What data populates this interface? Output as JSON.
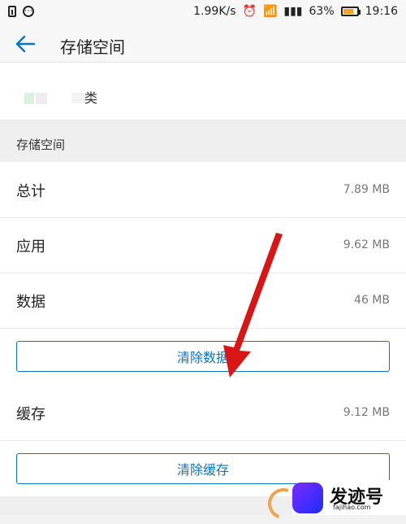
{
  "status_bar": {
    "speed": "1.99K/s",
    "battery": "63%",
    "time": "19:16"
  },
  "header": {
    "title": "存储空间"
  },
  "app": {
    "name_fragment": "类"
  },
  "section": {
    "title": "存储空间"
  },
  "rows": {
    "total": {
      "label": "总计",
      "value": "7.89 MB"
    },
    "app": {
      "label": "应用",
      "value": "9.62 MB"
    },
    "data": {
      "label": "数据",
      "value": "46 MB"
    },
    "cache": {
      "label": "缓存",
      "value": "9.12 MB"
    }
  },
  "buttons": {
    "clear_data": "清除数据",
    "clear_cache": "清除缓存"
  },
  "watermark": {
    "title": "发迹号",
    "url": "fajihao.com"
  },
  "colors": {
    "accent": "#0a74bd",
    "battery": "#f3a31d",
    "arrow": "#d81616"
  }
}
